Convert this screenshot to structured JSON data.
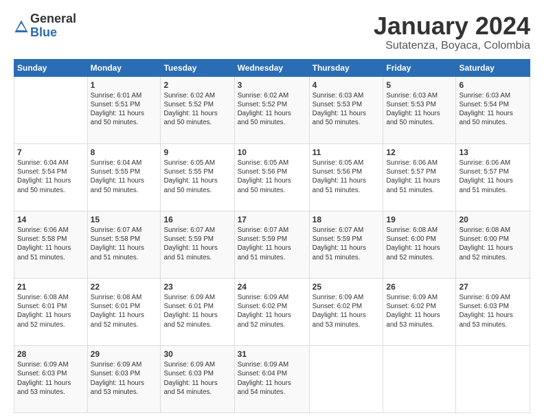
{
  "logo": {
    "general": "General",
    "blue": "Blue"
  },
  "header": {
    "month_year": "January 2024",
    "location": "Sutatenza, Boyaca, Colombia"
  },
  "weekdays": [
    "Sunday",
    "Monday",
    "Tuesday",
    "Wednesday",
    "Thursday",
    "Friday",
    "Saturday"
  ],
  "weeks": [
    [
      {
        "day": "",
        "detail": ""
      },
      {
        "day": "1",
        "detail": "Sunrise: 6:01 AM\nSunset: 5:51 PM\nDaylight: 11 hours\nand 50 minutes."
      },
      {
        "day": "2",
        "detail": "Sunrise: 6:02 AM\nSunset: 5:52 PM\nDaylight: 11 hours\nand 50 minutes."
      },
      {
        "day": "3",
        "detail": "Sunrise: 6:02 AM\nSunset: 5:52 PM\nDaylight: 11 hours\nand 50 minutes."
      },
      {
        "day": "4",
        "detail": "Sunrise: 6:03 AM\nSunset: 5:53 PM\nDaylight: 11 hours\nand 50 minutes."
      },
      {
        "day": "5",
        "detail": "Sunrise: 6:03 AM\nSunset: 5:53 PM\nDaylight: 11 hours\nand 50 minutes."
      },
      {
        "day": "6",
        "detail": "Sunrise: 6:03 AM\nSunset: 5:54 PM\nDaylight: 11 hours\nand 50 minutes."
      }
    ],
    [
      {
        "day": "7",
        "detail": "Sunrise: 6:04 AM\nSunset: 5:54 PM\nDaylight: 11 hours\nand 50 minutes."
      },
      {
        "day": "8",
        "detail": "Sunrise: 6:04 AM\nSunset: 5:55 PM\nDaylight: 11 hours\nand 50 minutes."
      },
      {
        "day": "9",
        "detail": "Sunrise: 6:05 AM\nSunset: 5:55 PM\nDaylight: 11 hours\nand 50 minutes."
      },
      {
        "day": "10",
        "detail": "Sunrise: 6:05 AM\nSunset: 5:56 PM\nDaylight: 11 hours\nand 50 minutes."
      },
      {
        "day": "11",
        "detail": "Sunrise: 6:05 AM\nSunset: 5:56 PM\nDaylight: 11 hours\nand 51 minutes."
      },
      {
        "day": "12",
        "detail": "Sunrise: 6:06 AM\nSunset: 5:57 PM\nDaylight: 11 hours\nand 51 minutes."
      },
      {
        "day": "13",
        "detail": "Sunrise: 6:06 AM\nSunset: 5:57 PM\nDaylight: 11 hours\nand 51 minutes."
      }
    ],
    [
      {
        "day": "14",
        "detail": "Sunrise: 6:06 AM\nSunset: 5:58 PM\nDaylight: 11 hours\nand 51 minutes."
      },
      {
        "day": "15",
        "detail": "Sunrise: 6:07 AM\nSunset: 5:58 PM\nDaylight: 11 hours\nand 51 minutes."
      },
      {
        "day": "16",
        "detail": "Sunrise: 6:07 AM\nSunset: 5:59 PM\nDaylight: 11 hours\nand 51 minutes."
      },
      {
        "day": "17",
        "detail": "Sunrise: 6:07 AM\nSunset: 5:59 PM\nDaylight: 11 hours\nand 51 minutes."
      },
      {
        "day": "18",
        "detail": "Sunrise: 6:07 AM\nSunset: 5:59 PM\nDaylight: 11 hours\nand 51 minutes."
      },
      {
        "day": "19",
        "detail": "Sunrise: 6:08 AM\nSunset: 6:00 PM\nDaylight: 11 hours\nand 52 minutes."
      },
      {
        "day": "20",
        "detail": "Sunrise: 6:08 AM\nSunset: 6:00 PM\nDaylight: 11 hours\nand 52 minutes."
      }
    ],
    [
      {
        "day": "21",
        "detail": "Sunrise: 6:08 AM\nSunset: 6:01 PM\nDaylight: 11 hours\nand 52 minutes."
      },
      {
        "day": "22",
        "detail": "Sunrise: 6:08 AM\nSunset: 6:01 PM\nDaylight: 11 hours\nand 52 minutes."
      },
      {
        "day": "23",
        "detail": "Sunrise: 6:09 AM\nSunset: 6:01 PM\nDaylight: 11 hours\nand 52 minutes."
      },
      {
        "day": "24",
        "detail": "Sunrise: 6:09 AM\nSunset: 6:02 PM\nDaylight: 11 hours\nand 52 minutes."
      },
      {
        "day": "25",
        "detail": "Sunrise: 6:09 AM\nSunset: 6:02 PM\nDaylight: 11 hours\nand 53 minutes."
      },
      {
        "day": "26",
        "detail": "Sunrise: 6:09 AM\nSunset: 6:02 PM\nDaylight: 11 hours\nand 53 minutes."
      },
      {
        "day": "27",
        "detail": "Sunrise: 6:09 AM\nSunset: 6:03 PM\nDaylight: 11 hours\nand 53 minutes."
      }
    ],
    [
      {
        "day": "28",
        "detail": "Sunrise: 6:09 AM\nSunset: 6:03 PM\nDaylight: 11 hours\nand 53 minutes."
      },
      {
        "day": "29",
        "detail": "Sunrise: 6:09 AM\nSunset: 6:03 PM\nDaylight: 11 hours\nand 53 minutes."
      },
      {
        "day": "30",
        "detail": "Sunrise: 6:09 AM\nSunset: 6:03 PM\nDaylight: 11 hours\nand 54 minutes."
      },
      {
        "day": "31",
        "detail": "Sunrise: 6:09 AM\nSunset: 6:04 PM\nDaylight: 11 hours\nand 54 minutes."
      },
      {
        "day": "",
        "detail": ""
      },
      {
        "day": "",
        "detail": ""
      },
      {
        "day": "",
        "detail": ""
      }
    ]
  ]
}
